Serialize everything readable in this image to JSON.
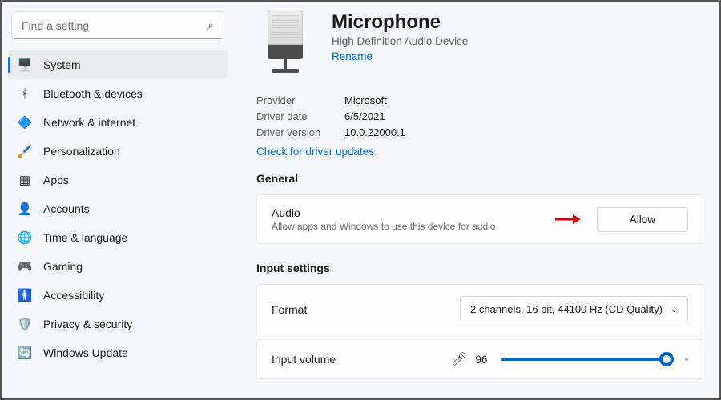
{
  "icons": {
    "system": "🖥️",
    "bluetooth": "ᚼ",
    "network": "🔷",
    "personalization": "🖌️",
    "apps": "▦",
    "accounts": "👤",
    "time": "🌐",
    "gaming": "🎮",
    "accessibility": "🚹",
    "privacy": "🛡️",
    "update": "🔄"
  },
  "search": {
    "placeholder": "Find a setting"
  },
  "sidebar": {
    "items": [
      {
        "label": "System",
        "icon": "system",
        "active": true
      },
      {
        "label": "Bluetooth & devices",
        "icon": "bluetooth"
      },
      {
        "label": "Network & internet",
        "icon": "network"
      },
      {
        "label": "Personalization",
        "icon": "personalization"
      },
      {
        "label": "Apps",
        "icon": "apps"
      },
      {
        "label": "Accounts",
        "icon": "accounts"
      },
      {
        "label": "Time & language",
        "icon": "time"
      },
      {
        "label": "Gaming",
        "icon": "gaming"
      },
      {
        "label": "Accessibility",
        "icon": "accessibility"
      },
      {
        "label": "Privacy & security",
        "icon": "privacy"
      },
      {
        "label": "Windows Update",
        "icon": "update"
      }
    ]
  },
  "header": {
    "title": "Microphone",
    "subtitle": "High Definition Audio Device",
    "rename": "Rename"
  },
  "meta": {
    "provider_k": "Provider",
    "provider_v": "Microsoft",
    "date_k": "Driver date",
    "date_v": "6/5/2021",
    "version_k": "Driver version",
    "version_v": "10.0.22000.1",
    "updates_link": "Check for driver updates"
  },
  "general": {
    "section": "General",
    "audio_title": "Audio",
    "audio_desc": "Allow apps and Windows to use this device for audio",
    "allow_btn": "Allow"
  },
  "input_settings": {
    "section": "Input settings",
    "format_label": "Format",
    "format_value": "2 channels, 16 bit, 44100 Hz (CD Quality)",
    "volume_label": "Input volume",
    "volume_value": "96",
    "volume_pct": 96
  }
}
